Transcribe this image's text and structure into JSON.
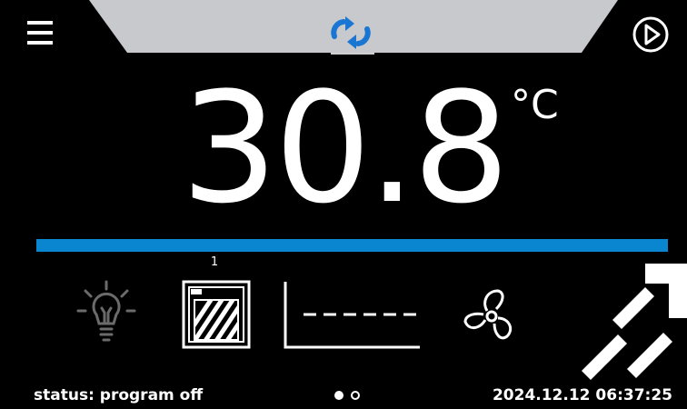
{
  "header": {
    "menu_icon": "hamburger-menu-icon",
    "mode_icon": "cycle-arrows-icon",
    "play_icon": "play-circle-icon",
    "tab_color": "#c8c9cc"
  },
  "temperature": {
    "value": "30.8",
    "unit": "°C",
    "bar_color": "#0a86d1"
  },
  "icons": {
    "light": "light-bulb-icon",
    "door": "door-icon",
    "door_counter": "1",
    "chart": "program-chart-icon",
    "fan": "fan-icon"
  },
  "footer": {
    "status": "status: program off",
    "page_dots": {
      "count": 2,
      "active": 1
    },
    "datetime": "2024.12.12  06:37:25"
  }
}
